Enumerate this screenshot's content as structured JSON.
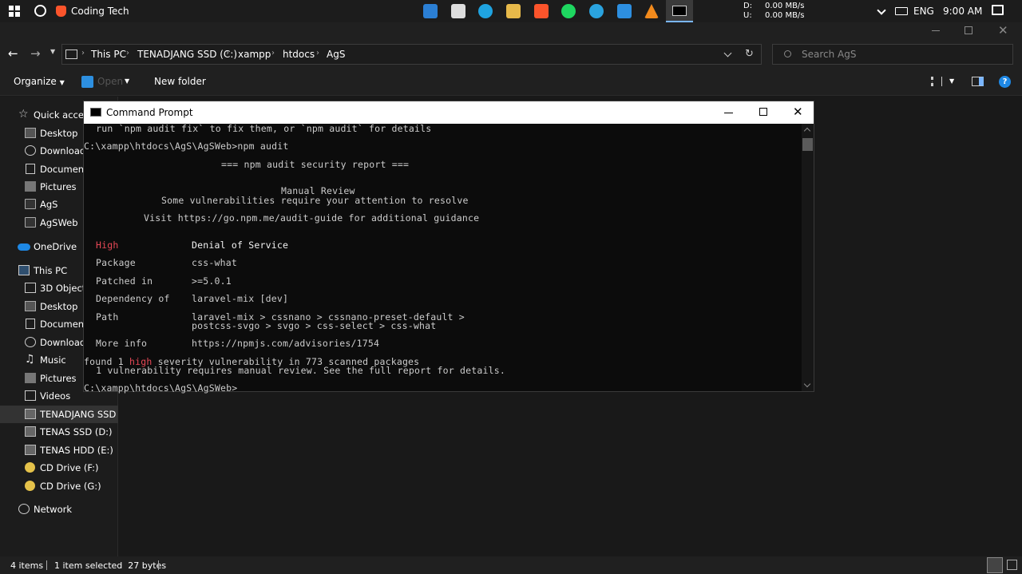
{
  "taskbar": {
    "active_tab": "Coding Tech",
    "net_down_label": "D:",
    "net_down": "0.00 MB/s",
    "net_up_label": "U:",
    "net_up": "0.00 MB/s",
    "language": "ENG",
    "time": "9:00 AM"
  },
  "address": {
    "segments": [
      "This PC",
      "TENADJANG SSD (C:)",
      "xampp",
      "htdocs",
      "AgS"
    ],
    "search_placeholder": "Search AgS"
  },
  "commandbar": {
    "organize": "Organize",
    "open": "Open",
    "new_folder": "New folder"
  },
  "nav": {
    "quick_access": "Quick access",
    "quick_items": [
      "Desktop",
      "Downloads",
      "Documents",
      "Pictures",
      "AgS",
      "AgSWeb"
    ],
    "onedrive": "OneDrive",
    "this_pc": "This PC",
    "pc_items": [
      "3D Objects",
      "Desktop",
      "Documents",
      "Downloads",
      "Music",
      "Pictures",
      "Videos"
    ],
    "drives": [
      "TENADJANG SSD (C:)",
      "TENAS SSD (D:)",
      "TENAS HDD (E:)",
      "CD Drive (F:)",
      "CD Drive (G:)"
    ],
    "network": "Network"
  },
  "status": {
    "items": "4 items",
    "selected": "1 item selected  27 bytes"
  },
  "cmd": {
    "title": "Command Prompt",
    "lines": {
      "l1": " run `npm audit fix` to fix them, or `npm audit` for details",
      "l2": "C:\\xampp\\htdocs\\AgS\\AgSWeb>npm audit",
      "l3": "=== npm audit security report ===",
      "l4": "Manual Review",
      "l5": "Some vulnerabilities require your attention to resolve",
      "l6": "Visit https://go.npm.me/audit-guide for additional guidance",
      "sev_label": "High",
      "sev_value": "Denial of Service",
      "pkg_label": "Package",
      "pkg_value": "css-what",
      "patched_label": "Patched in",
      "patched_value": ">=5.0.1",
      "dep_label": "Dependency of",
      "dep_value": "laravel-mix [dev]",
      "path_label": "Path",
      "path_value1": "laravel-mix > cssnano > cssnano-preset-default >",
      "path_value2": "postcss-svgo > svgo > css-select > css-what",
      "info_label": "More info",
      "info_value": "https://npmjs.com/advisories/1754",
      "found_a": "found 1 ",
      "found_b": "high",
      "found_c": " severity vulnerability in 773 scanned packages",
      "manual": " 1 vulnerability requires manual review. See the full report for details.",
      "prompt": "C:\\xampp\\htdocs\\AgS\\AgSWeb>"
    }
  }
}
